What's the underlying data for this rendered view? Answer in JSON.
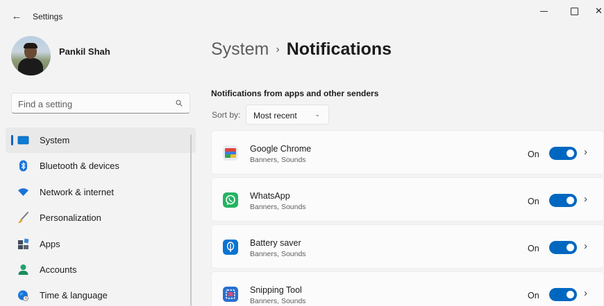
{
  "window": {
    "title": "Settings",
    "back_glyph": "←",
    "close_glyph": "✕"
  },
  "profile": {
    "name": "Pankil Shah"
  },
  "search": {
    "placeholder": "Find a setting",
    "icon": "search-icon"
  },
  "sidebar": {
    "items": [
      {
        "label": "System",
        "icon": "system-icon",
        "selected": true
      },
      {
        "label": "Bluetooth & devices",
        "icon": "bluetooth-icon"
      },
      {
        "label": "Network & internet",
        "icon": "wifi-icon"
      },
      {
        "label": "Personalization",
        "icon": "brush-icon"
      },
      {
        "label": "Apps",
        "icon": "apps-icon"
      },
      {
        "label": "Accounts",
        "icon": "accounts-icon"
      },
      {
        "label": "Time & language",
        "icon": "globe-clock-icon"
      }
    ]
  },
  "breadcrumb": {
    "parent": "System",
    "separator": "›",
    "current": "Notifications"
  },
  "section": {
    "title": "Notifications from apps and other senders"
  },
  "sort": {
    "label": "Sort by:",
    "value": "Most recent",
    "chevron": "⌄"
  },
  "apps": [
    {
      "name": "Google Chrome",
      "sub": "Banners, Sounds",
      "state": "On",
      "chevron": "›",
      "icon": "chrome-icon"
    },
    {
      "name": "WhatsApp",
      "sub": "Banners, Sounds",
      "state": "On",
      "chevron": "›",
      "icon": "whatsapp-icon"
    },
    {
      "name": "Battery saver",
      "sub": "Banners, Sounds",
      "state": "On",
      "chevron": "›",
      "icon": "battery-saver-icon"
    },
    {
      "name": "Snipping Tool",
      "sub": "Banners, Sounds",
      "state": "On",
      "chevron": "›",
      "icon": "snipping-tool-icon"
    }
  ],
  "colors": {
    "accent": "#0067c0",
    "background": "#f3f3f3",
    "card": "#fbfbfb"
  }
}
